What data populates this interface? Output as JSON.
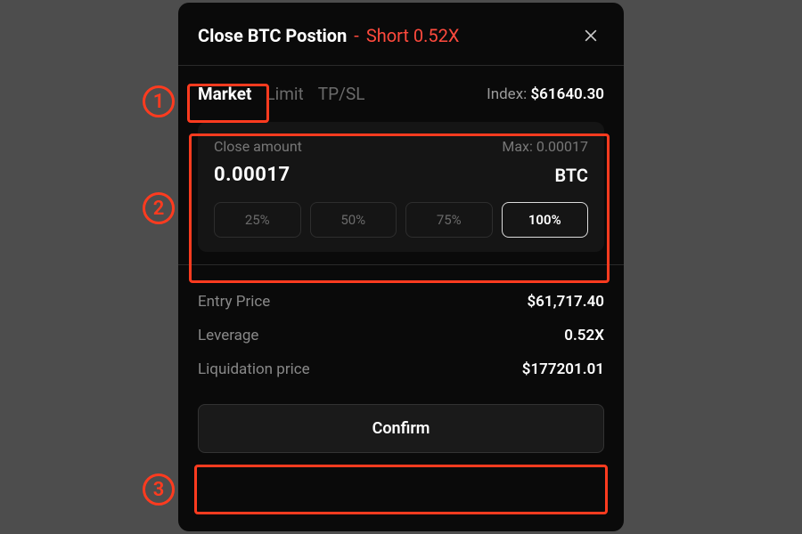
{
  "header": {
    "title": "Close BTC Postion",
    "dash": "-",
    "position": "Short 0.52X"
  },
  "tabs": {
    "market": "Market",
    "limit": "Limit",
    "tpsl": "TP/SL"
  },
  "index": {
    "label": "Index:",
    "value": "$61640.30"
  },
  "amount": {
    "label": "Close amount",
    "max_label": "Max: 0.00017",
    "value": "0.00017",
    "unit": "BTC",
    "percents": {
      "p25": "25%",
      "p50": "50%",
      "p75": "75%",
      "p100": "100%"
    }
  },
  "details": {
    "entry_label": "Entry Price",
    "entry_value": "$61,717.40",
    "leverage_label": "Leverage",
    "leverage_value": "0.52X",
    "liq_label": "Liquidation price",
    "liq_value": "$177201.01"
  },
  "confirm_label": "Confirm",
  "annotations": {
    "n1": "1",
    "n2": "2",
    "n3": "3"
  }
}
